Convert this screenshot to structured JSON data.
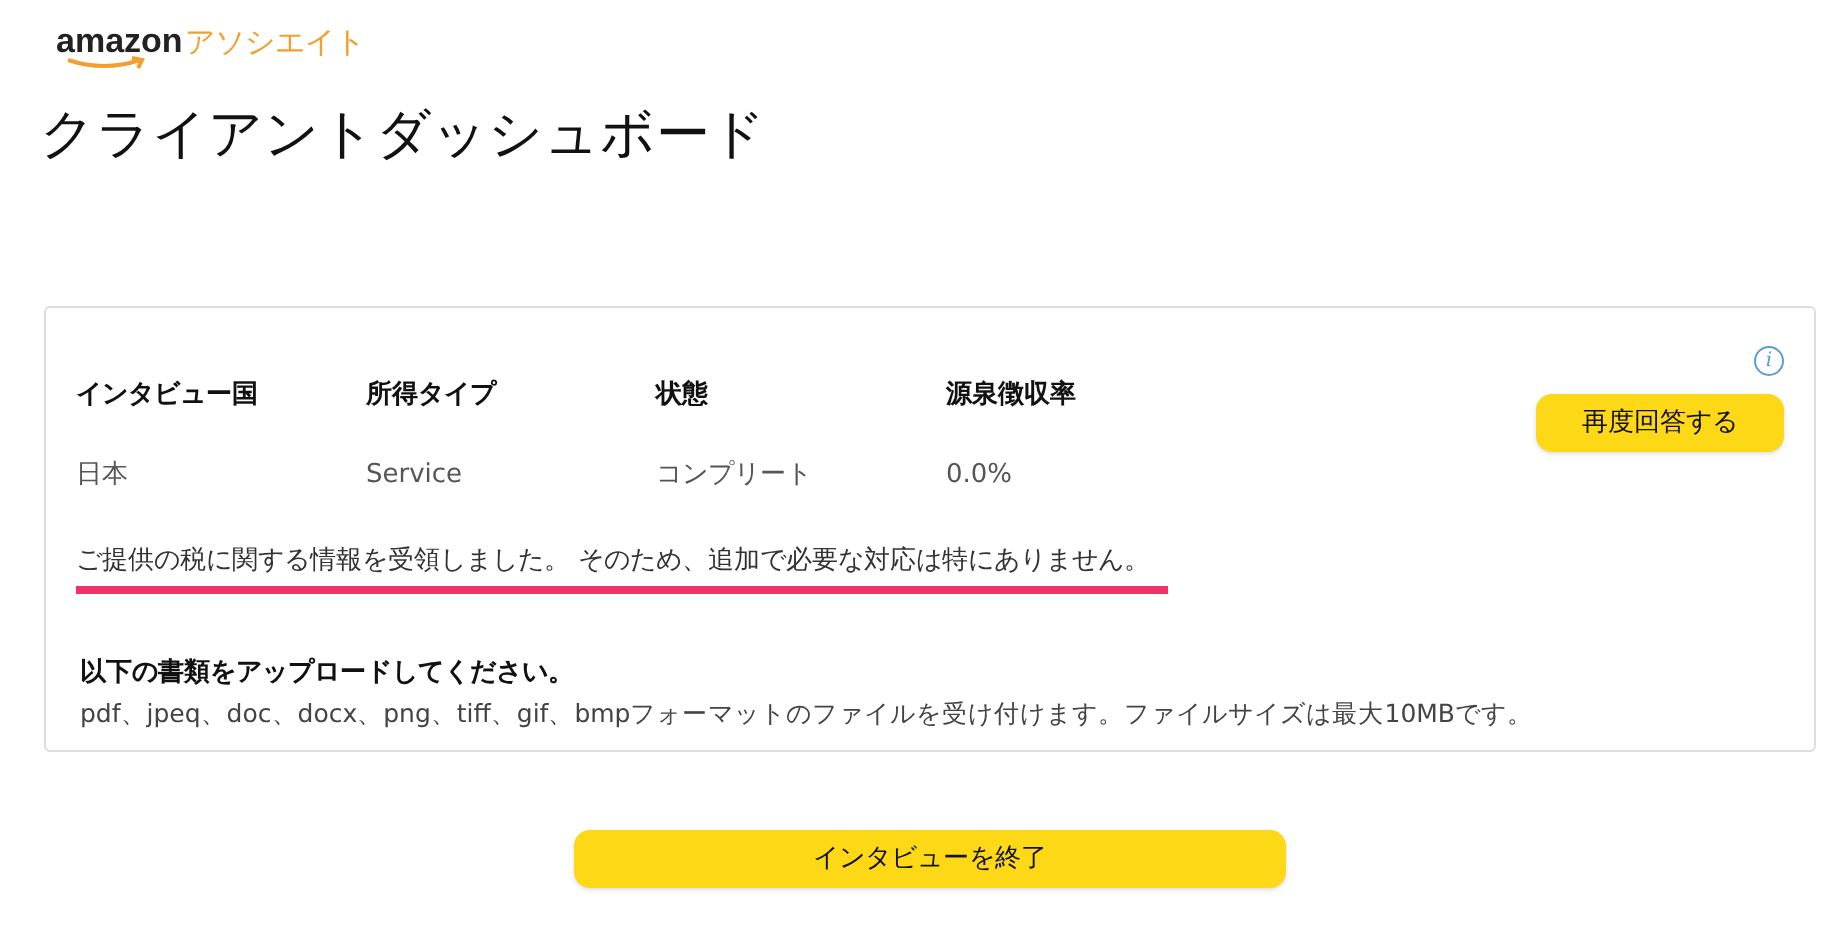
{
  "logo": {
    "brand": "amazon",
    "suffix": "アソシエイト"
  },
  "title": "クライアントダッシュボード",
  "summary": {
    "columns": [
      {
        "header": "インタビュー国",
        "value": "日本"
      },
      {
        "header": "所得タイプ",
        "value": "Service"
      },
      {
        "header": "状態",
        "value": "コンプリート"
      },
      {
        "header": "源泉徴収率",
        "value": "0.0%"
      }
    ],
    "info_icon": "i",
    "reanswer_button": "再度回答する",
    "message": {
      "text": "ご提供の税に関する情報を受領しました。 そのため、追加で必要な対応は特にありません。",
      "highlighted": true
    },
    "upload_title": "以下の書類をアップロードしてください。",
    "upload_note": "pdf、jpeq、doc、docx、png、tiff、gif、bmpフォーマットのファイルを受け付けます。ファイルサイズは最大10MBです。"
  },
  "finish_button": "インタビューを終了"
}
